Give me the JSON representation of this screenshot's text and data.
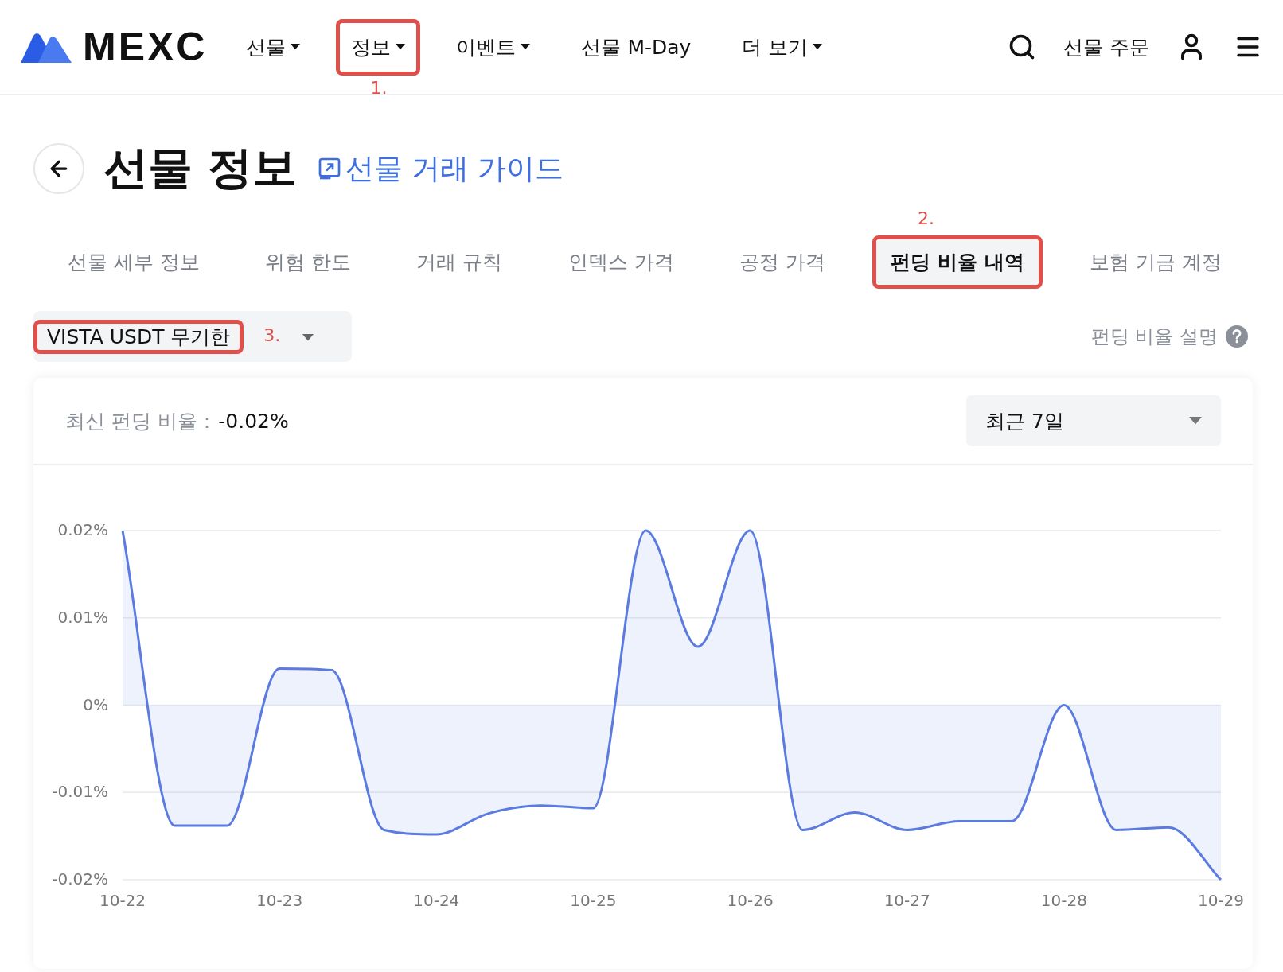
{
  "header": {
    "logo": "MEXC",
    "nav": [
      {
        "label": "선물",
        "dropdown": true
      },
      {
        "label": "정보",
        "dropdown": true,
        "annotation": "1."
      },
      {
        "label": "이벤트",
        "dropdown": true
      },
      {
        "label": "선물 M-Day",
        "dropdown": false
      },
      {
        "label": "더 보기",
        "dropdown": true
      }
    ],
    "order_link": "선물 주문"
  },
  "page": {
    "title": "선물 정보",
    "guide_link": "선물 거래 가이드"
  },
  "tabs": [
    {
      "label": "선물 세부 정보",
      "selected": false
    },
    {
      "label": "위험 한도",
      "selected": false
    },
    {
      "label": "거래 규칙",
      "selected": false
    },
    {
      "label": "인덱스 가격",
      "selected": false
    },
    {
      "label": "공정 가격",
      "selected": false
    },
    {
      "label": "펀딩 비율 내역",
      "selected": true,
      "annotation": "2."
    },
    {
      "label": "보험 기금 계정",
      "selected": false
    }
  ],
  "contract_select": {
    "value": "VISTA USDT 무기한",
    "annotation": "3."
  },
  "help_link": "펀딩 비율 설명",
  "card": {
    "latest_label": "최신 펀딩 비율 :",
    "latest_value": "-0.02%",
    "period_select": {
      "value": "최근 7일"
    },
    "chart_data": {
      "type": "area",
      "categories": [
        "10-22",
        null,
        null,
        "10-23",
        null,
        null,
        "10-24",
        null,
        null,
        "10-25",
        null,
        null,
        "10-26",
        null,
        null,
        "10-27",
        null,
        null,
        "10-28",
        null,
        null,
        "10-29"
      ],
      "series": [
        {
          "color": "#5b7be0",
          "values": [
            0.02,
            -0.0138,
            -0.0138,
            0.0042,
            0.004,
            -0.0143,
            -0.0148,
            -0.0124,
            -0.0115,
            -0.0118,
            0.02,
            0.0067,
            0.02,
            -0.0143,
            -0.0123,
            -0.0143,
            -0.0133,
            -0.0133,
            0,
            -0.0143,
            -0.014,
            -0.02
          ]
        }
      ],
      "ylim": [
        -0.02,
        0.02
      ],
      "grid": true,
      "yticks": [
        {
          "value": 0.02,
          "label": "0.02%"
        },
        {
          "value": 0.01,
          "label": "0.01%"
        },
        {
          "value": 0,
          "label": "0%"
        },
        {
          "value": -0.01,
          "label": "-0.01%"
        },
        {
          "value": -0.02,
          "label": "-0.02%"
        }
      ]
    }
  }
}
